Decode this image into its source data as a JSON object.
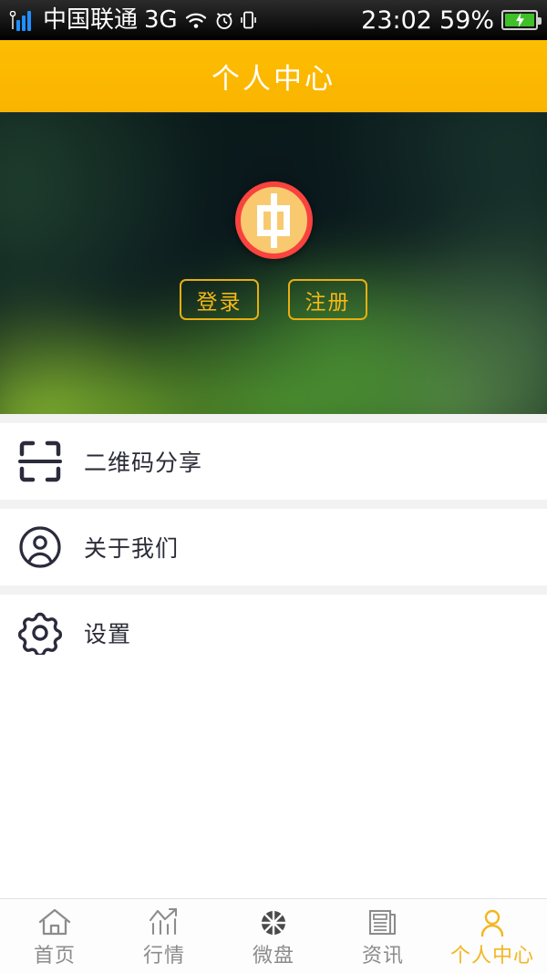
{
  "statusbar": {
    "carrier": "中国联通",
    "network": "3G",
    "time": "23:02",
    "battery_percent": "59%",
    "icons": [
      "signal-bars-icon",
      "wifi-icon",
      "alarm-icon",
      "vibrate-icon",
      "battery-charging-icon"
    ]
  },
  "header": {
    "title": "个人中心",
    "background_color": "#fcb900",
    "text_color": "#ffffff"
  },
  "hero": {
    "avatar_name": "user-avatar-logo",
    "avatar_ring_color": "#f8433f",
    "avatar_fill_color": "#f8c96f",
    "login_label": "登录",
    "register_label": "注册",
    "button_border_color": "#e8ae12",
    "button_text_color": "#f5b816"
  },
  "menu": {
    "items": [
      {
        "label": "二维码分享",
        "icon": "scan-qr-icon"
      },
      {
        "label": "关于我们",
        "icon": "user-circle-icon"
      },
      {
        "label": "设置",
        "icon": "gear-icon"
      }
    ]
  },
  "tabbar": {
    "active_color": "#f4b521",
    "inactive_color": "#8c8c8c",
    "tabs": [
      {
        "label": "首页",
        "icon": "home-icon",
        "active": false
      },
      {
        "label": "行情",
        "icon": "trend-chart-icon",
        "active": false
      },
      {
        "label": "微盘",
        "icon": "pie-wheel-icon",
        "active": false
      },
      {
        "label": "资讯",
        "icon": "news-document-icon",
        "active": false
      },
      {
        "label": "个人中心",
        "icon": "person-icon",
        "active": true
      }
    ]
  }
}
